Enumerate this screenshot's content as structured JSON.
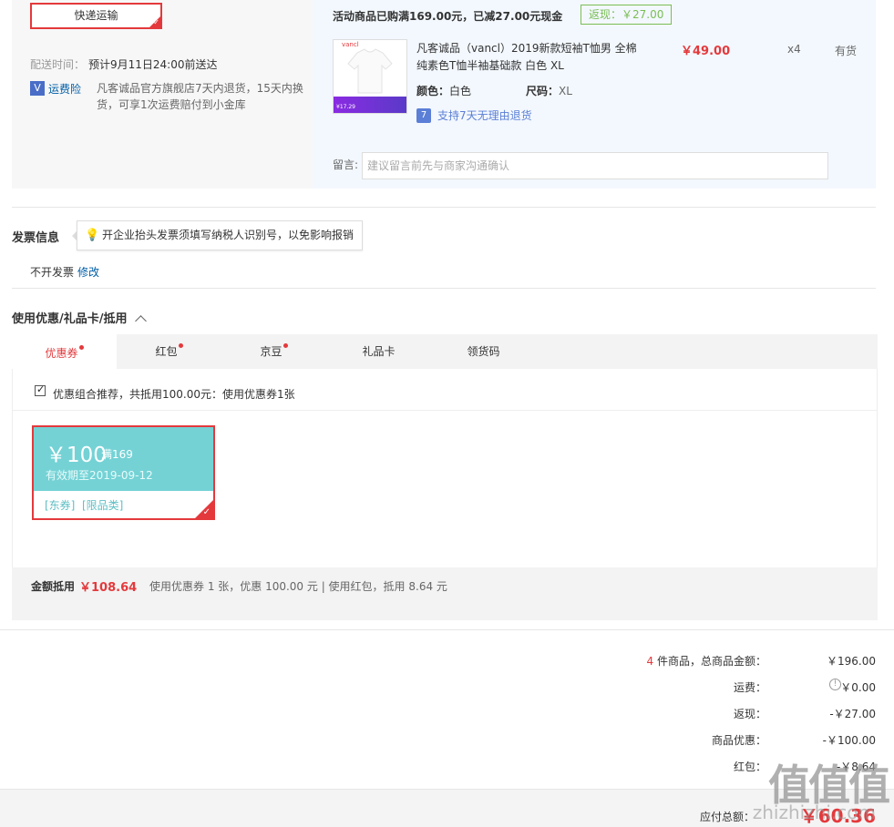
{
  "shipping": {
    "method_label": "快递运输",
    "delivery_label": "配送时间：",
    "delivery_value": "预计9月11日24:00前送达",
    "insurance_icon": "V",
    "insurance_label": "运费险",
    "insurance_desc_line1": "凡客诚品官方旗舰店7天内退货，15天内换",
    "insurance_desc_line2": "货，可享1次运费赔付到小金库"
  },
  "promo": {
    "text": "活动商品已购满169.00元，已减27.00元现金",
    "cashback_tag": "返现：￥27.00"
  },
  "product": {
    "image_brand": "vancl",
    "image_price": "¥17.29",
    "title_line1": "凡客诚品（vancl）2019新款短袖T恤男 全棉",
    "title_line2": "纯素色T恤半袖基础款 白色 XL",
    "price": "￥49.00",
    "quantity": "x4",
    "stock": "有货",
    "color_label": "颜色：",
    "color_value": "白色",
    "size_label": "尺码：",
    "size_value": "XL",
    "return_badge": "7",
    "return_text": "支持7天无理由退货"
  },
  "remark": {
    "label": "留言:",
    "placeholder": "建议留言前先与商家沟通确认"
  },
  "invoice": {
    "title": "发票信息",
    "tip": "开企业抬头发票须填写纳税人识别号，以免影响报销",
    "value": "不开发票",
    "edit_link": "修改"
  },
  "discount": {
    "title": "使用优惠/礼品卡/抵用",
    "tabs": [
      {
        "label": "优惠券",
        "dot": true
      },
      {
        "label": "红包",
        "dot": true
      },
      {
        "label": "京豆",
        "dot": true
      },
      {
        "label": "礼品卡",
        "dot": false
      },
      {
        "label": "领货码",
        "dot": false
      }
    ],
    "combo_text": "优惠组合推荐，共抵用100.00元：使用优惠券1张",
    "coupon": {
      "amount": "￥100",
      "condition": "满169",
      "validity": "有效期至2019-09-12",
      "tags": "[东券]  [限品类]"
    },
    "summary_label": "金额抵用",
    "summary_amount": "￥108.64",
    "summary_detail": "使用优惠券 1 张，优惠 100.00 元  | 使用红包，抵用 8.64 元"
  },
  "totals": {
    "count": "4",
    "count_suffix": " 件商品，总商品金额：",
    "goods_total": "￥196.00",
    "shipping_label": "运费：",
    "shipping_value": "￥0.00",
    "cashback_label": "返现：",
    "cashback_value": "-￥27.00",
    "goods_discount_label": "商品优惠：",
    "goods_discount_value": "-￥100.00",
    "redpacket_label": "红包：",
    "redpacket_value": "-￥8.64",
    "payable_label": "应付总额：",
    "payable_value": "￥60.36"
  },
  "watermark": {
    "logo": "值值值",
    "site": "zhizhizhi.com"
  },
  "colors": {
    "accent_red": "#e4393c",
    "coupon_teal": "#74d2d5",
    "link_blue": "#005ea7",
    "cashback_green": "#7abd54"
  }
}
